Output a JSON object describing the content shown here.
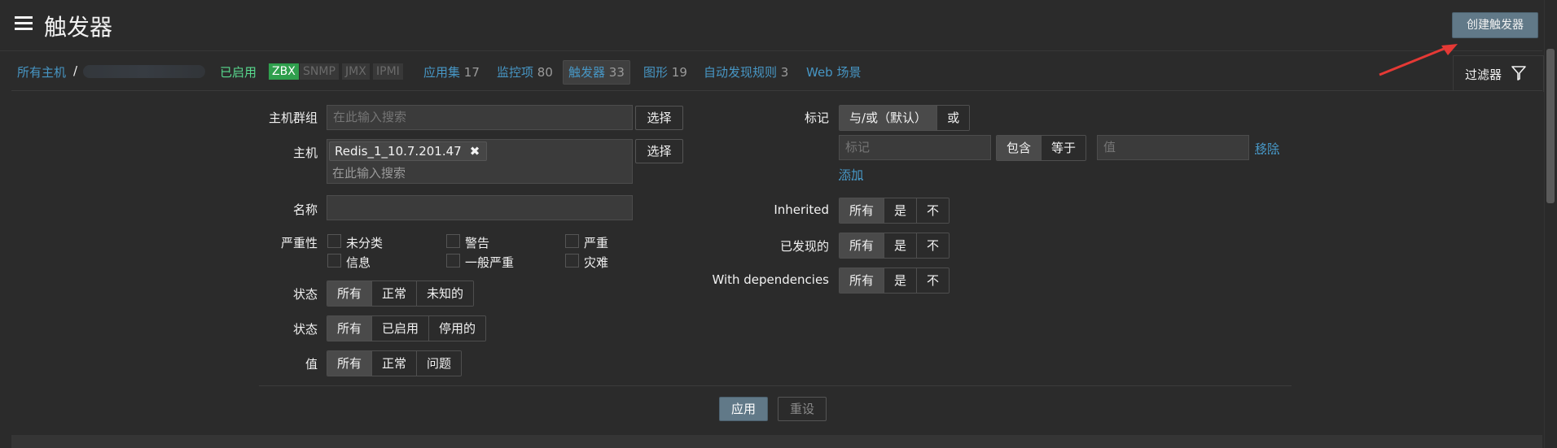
{
  "header": {
    "title": "触发器",
    "create_button": "创建触发器"
  },
  "breadcrumb": {
    "all_hosts": "所有主机",
    "separator": "/",
    "enabled": "已启用",
    "tags": [
      "ZBX",
      "SNMP",
      "JMX",
      "IPMI"
    ]
  },
  "nav": {
    "items": [
      {
        "label": "应用集",
        "count": "17"
      },
      {
        "label": "监控项",
        "count": "80"
      },
      {
        "label": "触发器",
        "count": "33"
      },
      {
        "label": "图形",
        "count": "19"
      },
      {
        "label": "自动发现规则",
        "count": "3"
      },
      {
        "label": "Web 场景",
        "count": ""
      }
    ]
  },
  "filter_tab": {
    "label": "过滤器",
    "icon": "filter-icon"
  },
  "filter": {
    "host_group": {
      "label": "主机群组",
      "placeholder": "在此输入搜索",
      "select": "选择"
    },
    "host": {
      "label": "主机",
      "chip": "Redis_1_10.7.201.47",
      "placeholder": "在此输入搜索",
      "select": "选择"
    },
    "name": {
      "label": "名称",
      "value": ""
    },
    "severity": {
      "label": "严重性",
      "options": [
        "未分类",
        "警告",
        "严重",
        "信息",
        "一般严重",
        "灾难"
      ]
    },
    "state": {
      "label": "状态",
      "options": [
        "所有",
        "正常",
        "未知的"
      ],
      "selected": 0
    },
    "status": {
      "label": "状态",
      "options": [
        "所有",
        "已启用",
        "停用的"
      ],
      "selected": 0
    },
    "value": {
      "label": "值",
      "options": [
        "所有",
        "正常",
        "问题"
      ],
      "selected": 0
    },
    "tags": {
      "label": "标记",
      "eval_options": [
        "与/或（默认）",
        "或"
      ],
      "eval_selected": 0,
      "tag_placeholder": "标记",
      "op_options": [
        "包含",
        "等于"
      ],
      "op_selected": 0,
      "value_placeholder": "值",
      "remove": "移除",
      "add": "添加"
    },
    "inherited": {
      "label": "Inherited",
      "options": [
        "所有",
        "是",
        "不"
      ],
      "selected": 0
    },
    "discovered": {
      "label": "已发现的",
      "options": [
        "所有",
        "是",
        "不"
      ],
      "selected": 0
    },
    "dependencies": {
      "label": "With dependencies",
      "options": [
        "所有",
        "是",
        "不"
      ],
      "selected": 0
    },
    "apply": "应用",
    "reset": "重设"
  },
  "colors": {
    "accent": "#617988",
    "link": "#4796c4",
    "enabled": "#59db8f",
    "arrow": "#e53935"
  }
}
